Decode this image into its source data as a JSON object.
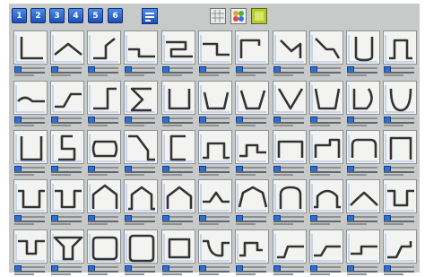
{
  "toolbar": {
    "page_buttons": [
      "1",
      "2",
      "3",
      "4",
      "5",
      "6"
    ],
    "tool_buttons": [
      "view-list-tool",
      "view-grid-tool",
      "palette-tool",
      "fill-tool"
    ]
  },
  "colors": {
    "workspace": "#c8cac9",
    "button_blue": "#1d4fb8",
    "profile_stroke": "#333333",
    "guide_blue": "#3d6fe0"
  },
  "profiles": [
    [
      "L-angle",
      "roof-ridge",
      "hip-cap",
      "step-flashing",
      "z-step-double",
      "z-step",
      "j-channel",
      "ridge-bend",
      "angled-step",
      "u-hairpin",
      "top-hat-open"
    ],
    [
      "wave-flat",
      "s-step",
      "j-hook",
      "s-curve",
      "box-channel",
      "u-shallow",
      "trapezoid-open",
      "v-trough",
      "cup",
      "d-gutter",
      "half-round"
    ],
    [
      "tall-box",
      "lock-hook",
      "rounded-slot",
      "diagonal-step",
      "c-bracket",
      "hat-section",
      "omega-step",
      "rect-cap",
      "offset-cap",
      "arch-cap",
      "tall-cap"
    ],
    [
      "u-flange",
      "hat-inverted",
      "pentagon",
      "pentagon-flange",
      "house",
      "peak-flat",
      "arch-peak",
      "round-top",
      "semi-flange",
      "wave-peak",
      "w-flange"
    ],
    [
      "valley-flange",
      "funnel",
      "rounded-rect",
      "rounded-box",
      "square-box",
      "dip-curve",
      "s-cap",
      "step-offset",
      "long-offset",
      "long-step",
      "long-z"
    ]
  ]
}
